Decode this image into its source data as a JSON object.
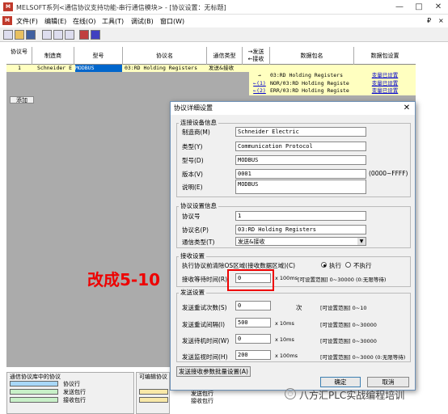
{
  "window": {
    "title": "MELSOFT系列<通信协议支持功能-串行通信模块> - [协议设置：无标题]",
    "min": "—",
    "max": "□",
    "close": "✕",
    "inner_max": "₽",
    "inner_close": "×"
  },
  "menu": [
    "文件(F)",
    "编辑(E)",
    "在线(O)",
    "工具(T)",
    "调试(B)",
    "窗口(W)"
  ],
  "table": {
    "headers": [
      "协议号",
      "制造商",
      "型号",
      "协议名",
      "通信类型",
      "→发送\n←接收",
      "数据包名",
      "数据包设置"
    ],
    "row": {
      "no": "1",
      "maker": "Schneider E",
      "model": "MODBUS",
      "protocol": "03:RD Holding Registers",
      "type": "发送&接收"
    },
    "packets": [
      {
        "dir": "→",
        "name": "03:RD Holding Registers",
        "setting": "变量已设置"
      },
      {
        "dir": "←(1)",
        "name": "NOR/03:RD Holding Registe",
        "setting": "变量已设置"
      },
      {
        "dir": "←(2)",
        "name": "ERR/03:RD Holding Registe",
        "setting": "变量已设置"
      }
    ],
    "add_label": "添加"
  },
  "dialog": {
    "title": "协议详细设置",
    "close": "✕",
    "conn_group": "连接设备信息",
    "maker_label": "制造商(M)",
    "maker": "Schneider Electric",
    "type_label": "类型(Y)",
    "type": "Communication Protocol",
    "model_label": "型号(D)",
    "model": "MODBUS",
    "version_label": "版本(V)",
    "version": "0001",
    "version_range": "(0000~FFFF)",
    "desc_label": "说明(E)",
    "desc": "MODBUS",
    "proto_group": "协议设置信息",
    "no_label": "协议号",
    "no": "1",
    "pname_label": "协议名(P)",
    "pname": "03:RD Holding Registers",
    "ctype_label": "通信类型(T)",
    "ctype": "发送&接收",
    "recv_group": "接收设置",
    "clear_label": "执行协议前清除OS区域(接收数据区域)(C)",
    "exec": "执行",
    "noexec": "不执行",
    "wait_label": "接收等待时间(R)",
    "wait": "0",
    "wait_unit": "x 100ms",
    "wait_range": "[可设置范围] 0~30000 (0:无限等待)",
    "send_group": "发送设置",
    "retry_label": "发送重试次数(S)",
    "retry": "0",
    "retry_unit": "次",
    "retry_range": "[可设置范围] 0~10",
    "interval_label": "发送重试间隔(I)",
    "interval": "500",
    "interval_unit": "x 10ms",
    "interval_range": "[可设置范围] 0~30000",
    "standby_label": "发送待机时间(W)",
    "standby": "0",
    "standby_unit": "x 10ms",
    "standby_range": "[可设置范围] 0~30000",
    "monitor_label": "发送监视时间(H)",
    "monitor": "200",
    "monitor_unit": "x 100ms",
    "monitor_range": "[可设置范围] 0~3000 (0:无限等待)",
    "batch_btn": "发送接收参数批量设置(A)",
    "ok": "确定",
    "cancel": "取消"
  },
  "annotation": "改成5-10",
  "legend": {
    "left_title": "通信协议库中的协议",
    "items": [
      "协议行",
      "发送包行",
      "接收包行"
    ],
    "right_title": "可编辑协议",
    "right_items": [
      "发送包行",
      "接收包行"
    ]
  },
  "watermark": "八方汇PLC实战编程培训",
  "colors": {
    "highlight": "#ee0000",
    "row": "#ffffc0"
  }
}
